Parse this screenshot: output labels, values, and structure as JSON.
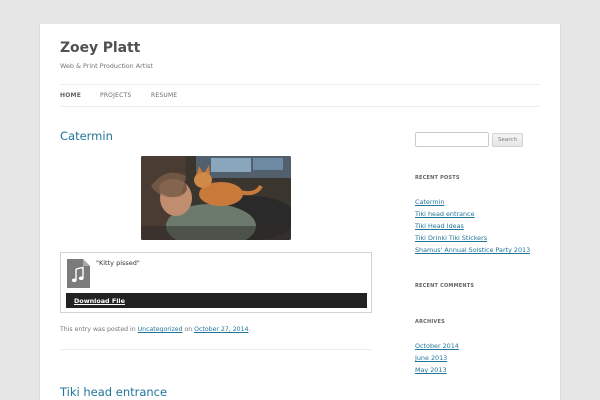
{
  "site": {
    "title": "Zoey Platt",
    "description": "Web & Print Production Artist"
  },
  "nav": {
    "items": [
      {
        "label": "HOME",
        "current": true
      },
      {
        "label": "PROJECTS",
        "current": false
      },
      {
        "label": "RESUME",
        "current": false
      }
    ]
  },
  "posts": [
    {
      "title": "Catermin",
      "attachment": {
        "caption": "\"Kitty pissed\"",
        "download_label": "Download File"
      },
      "meta": {
        "prefix": "This entry was posted in ",
        "category": "Uncategorized",
        "on": " on ",
        "date": "October 27, 2014",
        "suffix": "."
      }
    },
    {
      "title": "Tiki head entrance"
    }
  ],
  "sidebar": {
    "search": {
      "value": "",
      "button_label": "Search"
    },
    "recent_posts": {
      "title": "RECENT POSTS",
      "items": [
        "Catermin",
        "Tiki head entrance",
        "Tiki Head Ideas",
        "Tiki Drinki Tiki Stickers",
        "Shamus' Annual Solstice Party 2013"
      ]
    },
    "recent_comments": {
      "title": "RECENT COMMENTS"
    },
    "archives": {
      "title": "ARCHIVES",
      "items": [
        "October 2014",
        "June 2013",
        "May 2013"
      ]
    }
  },
  "colors": {
    "background": "#e6e6e6",
    "link": "#21759b",
    "download_bar": "#222222"
  }
}
